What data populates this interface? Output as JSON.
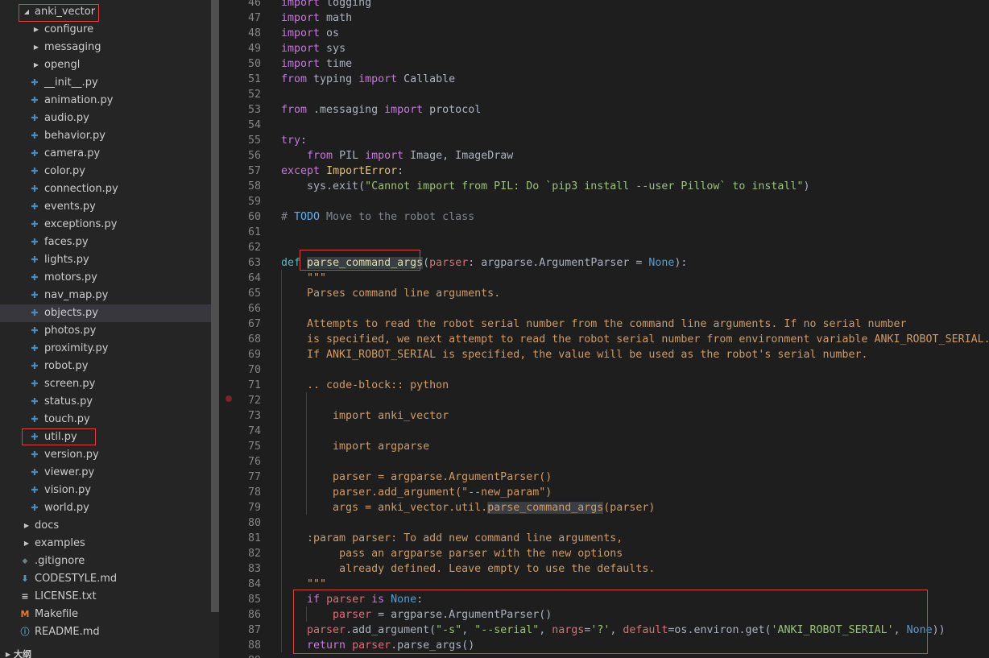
{
  "sidebar": {
    "items": [
      {
        "label": "anki_vector",
        "type": "folder-open",
        "depth": 1
      },
      {
        "label": "configure",
        "type": "folder",
        "depth": 2
      },
      {
        "label": "messaging",
        "type": "folder",
        "depth": 2
      },
      {
        "label": "opengl",
        "type": "folder",
        "depth": 2
      },
      {
        "label": "__init__.py",
        "type": "py",
        "depth": 2
      },
      {
        "label": "animation.py",
        "type": "py",
        "depth": 2
      },
      {
        "label": "audio.py",
        "type": "py",
        "depth": 2
      },
      {
        "label": "behavior.py",
        "type": "py",
        "depth": 2
      },
      {
        "label": "camera.py",
        "type": "py",
        "depth": 2
      },
      {
        "label": "color.py",
        "type": "py",
        "depth": 2
      },
      {
        "label": "connection.py",
        "type": "py",
        "depth": 2
      },
      {
        "label": "events.py",
        "type": "py",
        "depth": 2
      },
      {
        "label": "exceptions.py",
        "type": "py",
        "depth": 2
      },
      {
        "label": "faces.py",
        "type": "py",
        "depth": 2
      },
      {
        "label": "lights.py",
        "type": "py",
        "depth": 2
      },
      {
        "label": "motors.py",
        "type": "py",
        "depth": 2
      },
      {
        "label": "nav_map.py",
        "type": "py",
        "depth": 2
      },
      {
        "label": "objects.py",
        "type": "py",
        "depth": 2,
        "highlight": true
      },
      {
        "label": "photos.py",
        "type": "py",
        "depth": 2
      },
      {
        "label": "proximity.py",
        "type": "py",
        "depth": 2
      },
      {
        "label": "robot.py",
        "type": "py",
        "depth": 2
      },
      {
        "label": "screen.py",
        "type": "py",
        "depth": 2
      },
      {
        "label": "status.py",
        "type": "py",
        "depth": 2
      },
      {
        "label": "touch.py",
        "type": "py",
        "depth": 2
      },
      {
        "label": "util.py",
        "type": "py",
        "depth": 2
      },
      {
        "label": "version.py",
        "type": "py",
        "depth": 2
      },
      {
        "label": "viewer.py",
        "type": "py",
        "depth": 2
      },
      {
        "label": "vision.py",
        "type": "py",
        "depth": 2
      },
      {
        "label": "world.py",
        "type": "py",
        "depth": 2
      },
      {
        "label": "docs",
        "type": "folder",
        "depth": 1
      },
      {
        "label": "examples",
        "type": "folder",
        "depth": 1
      },
      {
        "label": ".gitignore",
        "type": "gitignore",
        "depth": 1
      },
      {
        "label": "CODESTYLE.md",
        "type": "md-down",
        "depth": 1
      },
      {
        "label": "LICENSE.txt",
        "type": "txt",
        "depth": 1
      },
      {
        "label": "Makefile",
        "type": "makefile",
        "depth": 1
      },
      {
        "label": "README.md",
        "type": "info",
        "depth": 1
      }
    ],
    "bottom_partial": "大纲",
    "colors": {
      "py": "#4b8bbe",
      "makefile": "#e37933",
      "md": "#519aba"
    }
  },
  "editor": {
    "lines": [
      {
        "n": "46",
        "html": "<span class='kw'>import</span> logging"
      },
      {
        "n": "47",
        "html": "<span class='kw'>import</span> math"
      },
      {
        "n": "48",
        "html": "<span class='kw'>import</span> os"
      },
      {
        "n": "49",
        "html": "<span class='kw'>import</span> sys"
      },
      {
        "n": "50",
        "html": "<span class='kw'>import</span> time"
      },
      {
        "n": "51",
        "html": "<span class='kw'>from</span> typing <span class='kw'>import</span> Callable"
      },
      {
        "n": "52",
        "html": ""
      },
      {
        "n": "53",
        "html": "<span class='kw'>from</span> .messaging <span class='kw'>import</span> protocol"
      },
      {
        "n": "54",
        "html": ""
      },
      {
        "n": "55",
        "html": "<span class='kw'>try</span>:"
      },
      {
        "n": "56",
        "html": "    <span class='kw'>from</span> PIL <span class='kw'>import</span> Image, ImageDraw"
      },
      {
        "n": "57",
        "html": "<span class='kw'>except</span> <span class='cls'>ImportError</span>:"
      },
      {
        "n": "58",
        "html": "    sys.exit(<span class='str'>\"Cannot import from PIL: Do `pip3 install --user Pillow` to install\"</span>)"
      },
      {
        "n": "59",
        "html": ""
      },
      {
        "n": "60",
        "html": "<span class='cmt'># </span><span class='tdo'>TODO</span><span class='cmt'> Move to the robot class</span>"
      },
      {
        "n": "61",
        "html": ""
      },
      {
        "n": "62",
        "html": ""
      },
      {
        "n": "63",
        "html": "<span class='kw2'>def</span> <span class='fn sel'>parse_command_args</span>(<span class='var'>parser</span>: argparse.ArgumentParser = <span class='cst'>None</span>):"
      },
      {
        "n": "64",
        "html": "    <span class='doc'>\"\"\"</span>"
      },
      {
        "n": "65",
        "html": "    <span class='doc'>Parses command line arguments.</span>"
      },
      {
        "n": "66",
        "html": ""
      },
      {
        "n": "67",
        "html": "    <span class='doc'>Attempts to read the robot serial number from the command line arguments. If no serial number</span>"
      },
      {
        "n": "68",
        "html": "    <span class='doc'>is specified, we next attempt to read the robot serial number from environment variable ANKI_ROBOT_SERIAL.</span>"
      },
      {
        "n": "69",
        "html": "    <span class='doc'>If ANKI_ROBOT_SERIAL is specified, the value will be used as the robot's serial number.</span>"
      },
      {
        "n": "70",
        "html": ""
      },
      {
        "n": "71",
        "html": "    <span class='doc'>.. code-block:: python</span>"
      },
      {
        "n": "72",
        "html": ""
      },
      {
        "n": "73",
        "html": "        <span class='doc'>import anki_vector</span>"
      },
      {
        "n": "74",
        "html": ""
      },
      {
        "n": "75",
        "html": "        <span class='doc'>import argparse</span>"
      },
      {
        "n": "76",
        "html": ""
      },
      {
        "n": "77",
        "html": "        <span class='doc'>parser = argparse.ArgumentParser()</span>"
      },
      {
        "n": "78",
        "html": "        <span class='doc'>parser.add_argument(\"--new_param\")</span>"
      },
      {
        "n": "79",
        "html": "        <span class='doc'>args = anki_vector.util.</span><span class='doc sel'>parse_command_args</span><span class='doc'>(parser)</span>"
      },
      {
        "n": "80",
        "html": ""
      },
      {
        "n": "81",
        "html": "    <span class='doc'>:param parser: To add new command line arguments,</span>"
      },
      {
        "n": "82",
        "html": "         <span class='doc'>pass an argparse parser with the new options</span>"
      },
      {
        "n": "83",
        "html": "         <span class='doc'>already defined. Leave empty to use the defaults.</span>"
      },
      {
        "n": "84",
        "html": "    <span class='doc'>\"\"\"</span>"
      },
      {
        "n": "85",
        "html": "    <span class='kw'>if</span> <span class='var'>parser</span> <span class='kw'>is</span> <span class='cst'>None</span>:"
      },
      {
        "n": "86",
        "html": "        <span class='var'>parser</span> = argparse.ArgumentParser()"
      },
      {
        "n": "87",
        "html": "    <span class='var'>parser</span>.add_argument(<span class='str'>\"-s\"</span>, <span class='str'>\"--serial\"</span>, <span class='var'>nargs</span>=<span class='str'>'?'</span>, <span class='var'>default</span>=os.environ.get(<span class='str'>'ANKI_ROBOT_SERIAL'</span>, <span class='cst'>None</span>))"
      },
      {
        "n": "88",
        "html": "    <span class='kw'>return</span> <span class='var'>parser</span>.parse_args()"
      },
      {
        "n": "89",
        "html": ""
      }
    ]
  }
}
